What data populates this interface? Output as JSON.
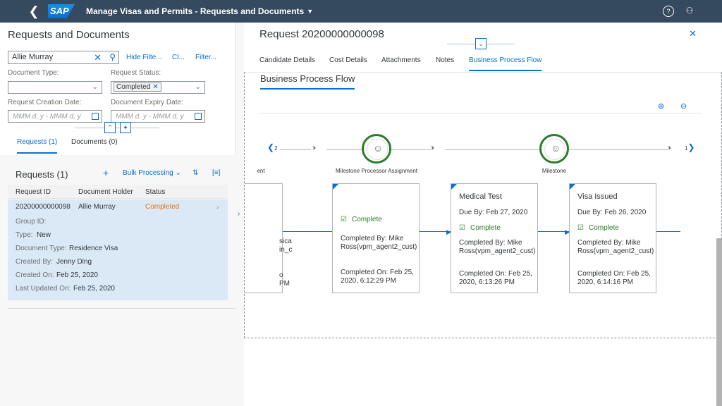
{
  "shell": {
    "back_icon": "back-icon",
    "logo": "SAP",
    "title": "Manage Visas and Permits - Requests and Documents"
  },
  "left": {
    "header": "Requests and Documents",
    "search_value": "Allie Murray",
    "links": [
      "Hide Filte...",
      "Cl...",
      "Filter..."
    ],
    "labels": {
      "doc_type": "Document Type:",
      "req_status": "Request Status:",
      "req_created": "Request Creation Date:",
      "doc_expiry": "Document Expiry Date:"
    },
    "status_token": "Completed",
    "date_placeholder": "MMM d, y - MMM d, y",
    "tabs": [
      "Requests (1)",
      "Documents (0)"
    ],
    "requests_title": "Requests (1)",
    "bulk": "Bulk Processing",
    "columns": [
      "Request ID",
      "Document Holder",
      "Status"
    ],
    "row": {
      "id": "20200000000098",
      "holder": "Allie Murray",
      "status": "Completed"
    },
    "details": [
      {
        "k": "Group ID:",
        "v": ""
      },
      {
        "k": "Type:",
        "v": "New"
      },
      {
        "k": "Document Type:",
        "v": "Residence Visa"
      },
      {
        "k": "Created By:",
        "v": "Jenny Ding"
      },
      {
        "k": "Created On:",
        "v": "Feb 25, 2020"
      },
      {
        "k": "Last Updated On:",
        "v": "Feb 25, 2020"
      }
    ]
  },
  "right": {
    "title": "Request 20200000000098",
    "tabs": [
      "Candidate Details",
      "Cost Details",
      "Attachments",
      "Notes",
      "Business Process Flow"
    ],
    "section_title": "Business Process Flow",
    "nav_left": "2",
    "nav_right": "1",
    "milestones": [
      "ent",
      "Milestone Processor Assignment",
      "Milestone"
    ],
    "cards": [
      {
        "title": "",
        "lines": [
          "sica",
          "in_c",
          "",
          "o",
          "PM"
        ]
      },
      {
        "title": "",
        "status": "Complete",
        "by": "Completed By: Mike Ross(vpm_agent2_cust)",
        "on": "Completed On: Feb 25, 2020, 6:12:29 PM"
      },
      {
        "title": "Medical Test",
        "due": "Due By: Feb 27, 2020",
        "status": "Complete",
        "by": "Completed By: Mike Ross(vpm_agent2_cust)",
        "on": "Completed On: Feb 25, 2020, 6:13:26 PM"
      },
      {
        "title": "Visa Issued",
        "due": "Due By: Feb 26, 2020",
        "status": "Complete",
        "by": "Completed By: Mike Ross(vpm_agent2_cust)",
        "on": "Completed On: Feb 25, 2020, 6:14:16 PM"
      }
    ]
  },
  "colors": {
    "shell": "#354a5f",
    "accent": "#0a6ed1",
    "success": "#2b7c2b",
    "warning": "#e9730c"
  }
}
